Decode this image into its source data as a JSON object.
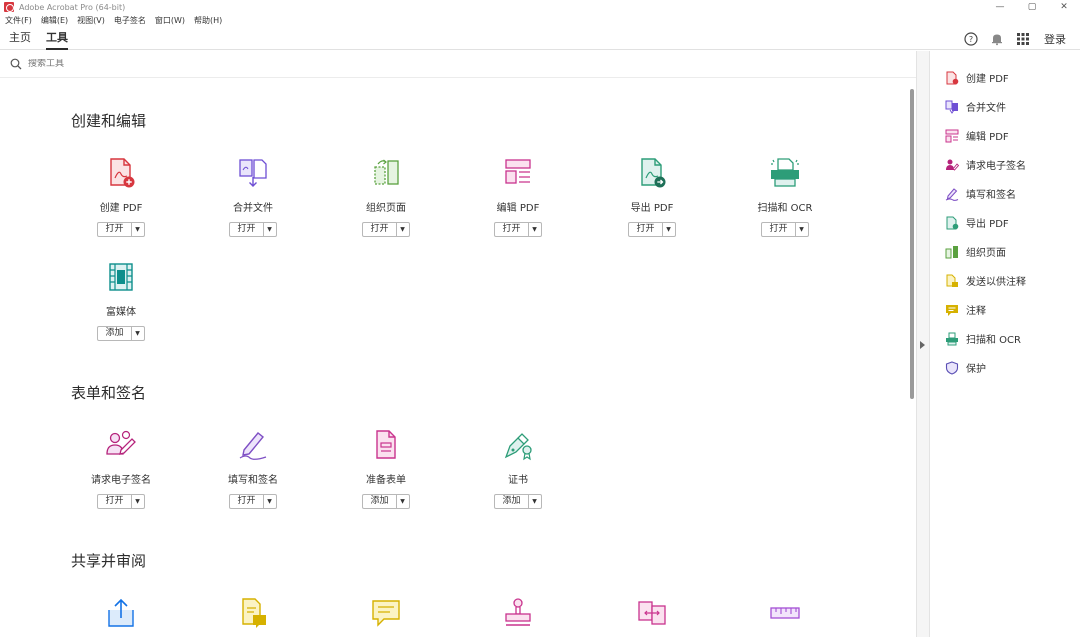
{
  "window": {
    "title": "Adobe Acrobat Pro (64-bit)",
    "minimize": "—",
    "maximize": "▢",
    "close": "✕"
  },
  "menu": [
    "文件(F)",
    "编辑(E)",
    "视图(V)",
    "电子签名",
    "窗口(W)",
    "帮助(H)"
  ],
  "tabs": {
    "home": "主页",
    "tools": "工具"
  },
  "header": {
    "login": "登录"
  },
  "search": {
    "placeholder": "搜索工具"
  },
  "sections": {
    "create_edit": {
      "title": "创建和编辑",
      "tools": [
        {
          "label": "创建 PDF",
          "button": "打开"
        },
        {
          "label": "合并文件",
          "button": "打开"
        },
        {
          "label": "组织页面",
          "button": "打开"
        },
        {
          "label": "编辑 PDF",
          "button": "打开"
        },
        {
          "label": "导出 PDF",
          "button": "打开"
        },
        {
          "label": "扫描和 OCR",
          "button": "打开"
        },
        {
          "label": "富媒体",
          "button": "添加"
        }
      ]
    },
    "forms_sign": {
      "title": "表单和签名",
      "tools": [
        {
          "label": "请求电子签名",
          "button": "打开"
        },
        {
          "label": "填写和签名",
          "button": "打开"
        },
        {
          "label": "准备表单",
          "button": "添加"
        },
        {
          "label": "证书",
          "button": "添加"
        }
      ]
    },
    "share_review": {
      "title": "共享并审阅"
    }
  },
  "right_panel": {
    "items": [
      {
        "label": "创建 PDF",
        "icon": "create-pdf-icon"
      },
      {
        "label": "合并文件",
        "icon": "combine-files-icon"
      },
      {
        "label": "编辑 PDF",
        "icon": "edit-pdf-icon"
      },
      {
        "label": "请求电子签名",
        "icon": "request-signature-icon"
      },
      {
        "label": "填写和签名",
        "icon": "fill-sign-icon"
      },
      {
        "label": "导出 PDF",
        "icon": "export-pdf-icon"
      },
      {
        "label": "组织页面",
        "icon": "organize-pages-icon"
      },
      {
        "label": "发送以供注释",
        "icon": "send-comments-icon"
      },
      {
        "label": "注释",
        "icon": "comment-icon"
      },
      {
        "label": "扫描和 OCR",
        "icon": "scan-ocr-icon"
      },
      {
        "label": "保护",
        "icon": "protect-icon"
      }
    ]
  },
  "colors": {
    "red": "#d7373f",
    "purple": "#6e4fd4",
    "pink": "#c9348e",
    "green": "#2d9d78",
    "teal": "#0d8f8c",
    "blue": "#1473e6",
    "yellow": "#d6b100",
    "magenta": "#b5237b"
  }
}
